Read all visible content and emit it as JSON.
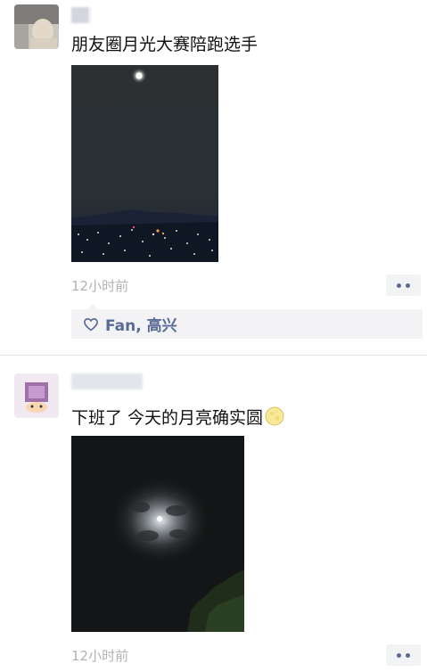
{
  "posts": [
    {
      "text": "朋友圈月光大赛陪跑选手",
      "time": "12小时前",
      "likes": "Fan, 高兴"
    },
    {
      "text": "下班了 今天的月亮确实圆",
      "text_emoji": "moon-emoji",
      "time": "12小时前"
    }
  ],
  "icons": {
    "more": "more-dots-icon",
    "like": "heart-icon"
  },
  "colors": {
    "link": "#576b95",
    "time": "#b2b2b2",
    "panel": "#f3f3f5"
  }
}
